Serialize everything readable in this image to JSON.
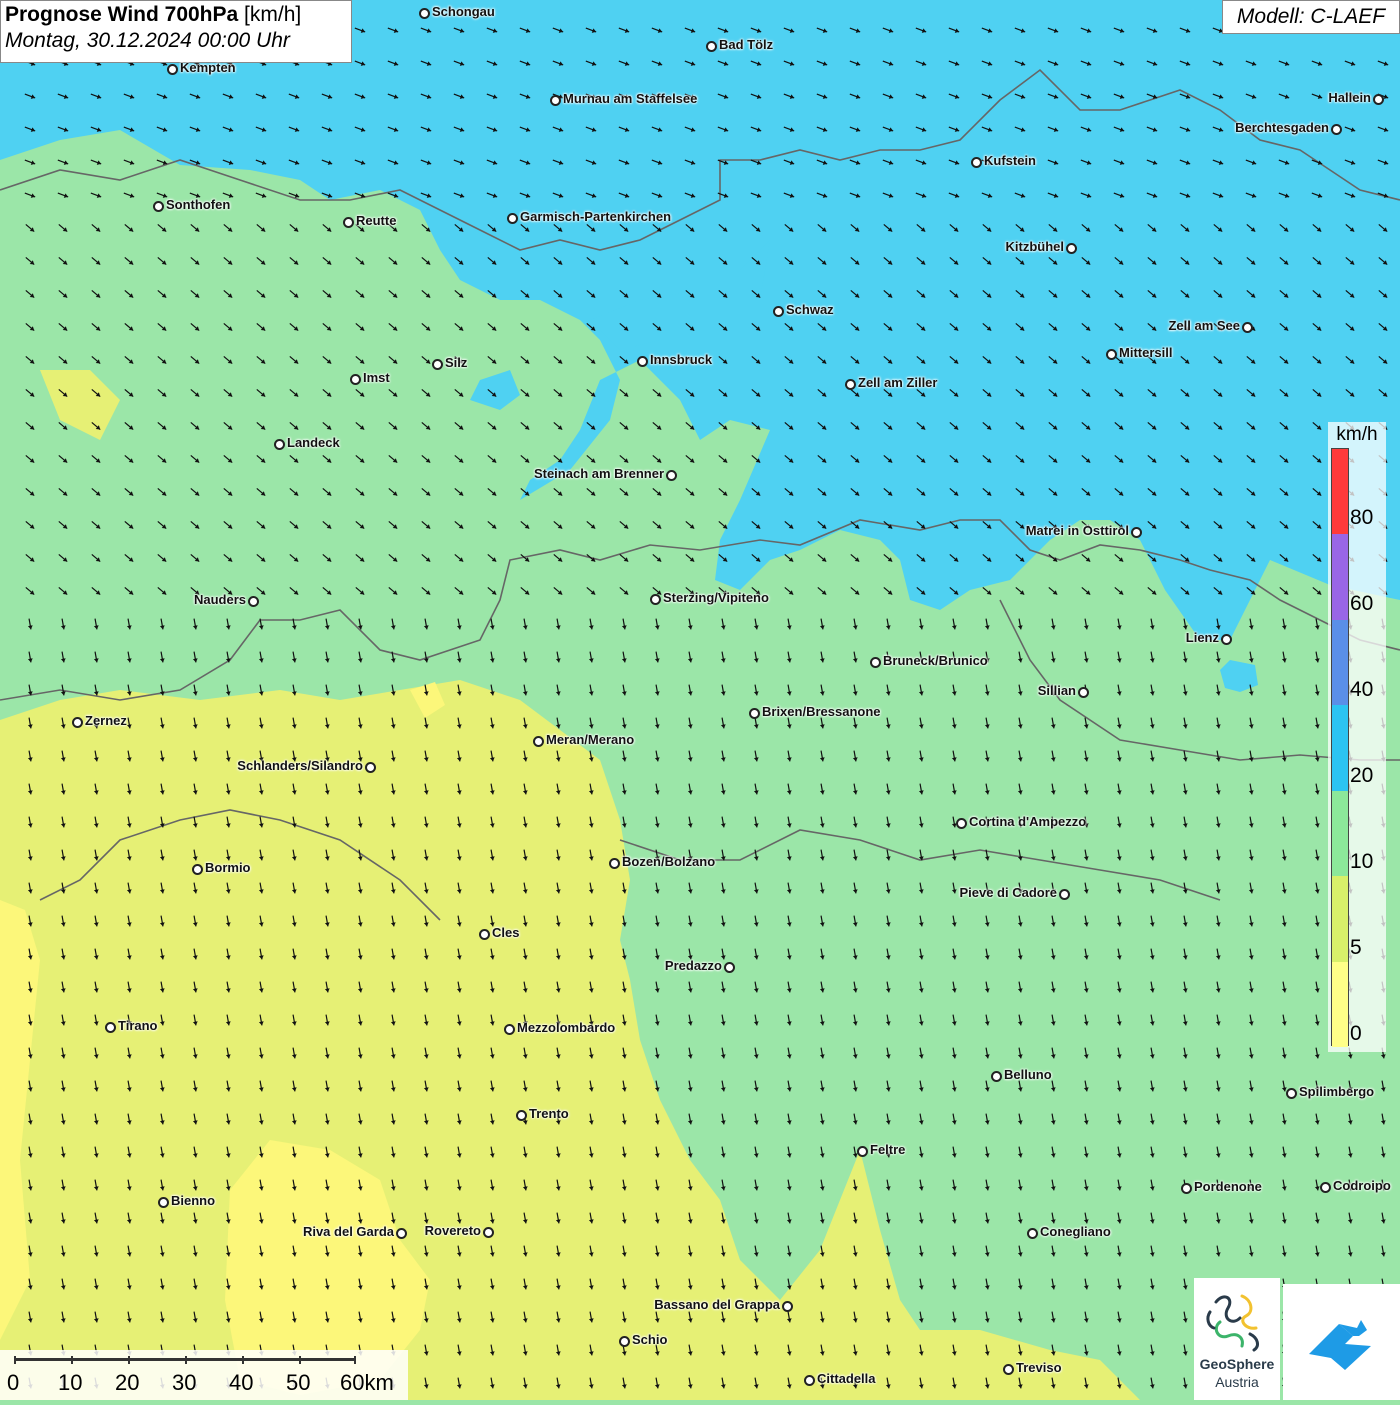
{
  "title": {
    "main": "Prognose Wind 700hPa",
    "unit": "[km/h]",
    "date": "Montag, 30.12.2024 00:00 Uhr"
  },
  "model": "Modell: C-LAEF",
  "legend": {
    "unit": "km/h",
    "labels": [
      "80",
      "60",
      "40",
      "20",
      "10",
      "5",
      "0"
    ],
    "colors": [
      "#ff3a3a",
      "#9966e6",
      "#5a8fe8",
      "#2cc4f2",
      "#8ce89a",
      "#d8f06a",
      "#ffff88"
    ]
  },
  "scale": {
    "labels": [
      "0",
      "10",
      "20",
      "30",
      "40",
      "50",
      "60km"
    ]
  },
  "logos": {
    "geosphere_name": "GeoSphere",
    "geosphere_sub": "Austria"
  },
  "colors": {
    "strong": "#4fd1f2",
    "medium": "#9be6a8",
    "weak": "#e6f075",
    "calm": "#fcf77a"
  },
  "cities": [
    {
      "name": "Schongau"
    },
    {
      "name": "Bad Tölz"
    },
    {
      "name": "Kempten"
    },
    {
      "name": "Murnau am Staffelsee"
    },
    {
      "name": "Hallein"
    },
    {
      "name": "Berchtesgaden"
    },
    {
      "name": "Kufstein"
    },
    {
      "name": "Sonthofen"
    },
    {
      "name": "Reutte"
    },
    {
      "name": "Garmisch-Partenkirchen"
    },
    {
      "name": "Kitzbühel"
    },
    {
      "name": "Schwaz"
    },
    {
      "name": "Zell am See"
    },
    {
      "name": "Innsbruck"
    },
    {
      "name": "Mittersill"
    },
    {
      "name": "Silz"
    },
    {
      "name": "Imst"
    },
    {
      "name": "Zell am Ziller"
    },
    {
      "name": "Landeck"
    },
    {
      "name": "Steinach am Brenner"
    },
    {
      "name": "Matrei in Osttirol"
    },
    {
      "name": "Nauders"
    },
    {
      "name": "Sterzing/Vipiteno"
    },
    {
      "name": "Lienz"
    },
    {
      "name": "Bruneck/Brunico"
    },
    {
      "name": "Sillian"
    },
    {
      "name": "Zernez"
    },
    {
      "name": "Brixen/Bressanone"
    },
    {
      "name": "Meran/Merano"
    },
    {
      "name": "Schlanders/Silandro"
    },
    {
      "name": "Cortina d'Ampezzo"
    },
    {
      "name": "Bozen/Bolzano"
    },
    {
      "name": "Bormio"
    },
    {
      "name": "Pieve di Cadore"
    },
    {
      "name": "Cles"
    },
    {
      "name": "Predazzo"
    },
    {
      "name": "Tirano"
    },
    {
      "name": "Mezzolombardo"
    },
    {
      "name": "Belluno"
    },
    {
      "name": "Spilimbergo"
    },
    {
      "name": "Trento"
    },
    {
      "name": "Feltre"
    },
    {
      "name": "Pordenone"
    },
    {
      "name": "Codroipo"
    },
    {
      "name": "Bienno"
    },
    {
      "name": "Riva del Garda"
    },
    {
      "name": "Rovereto"
    },
    {
      "name": "Conegliano"
    },
    {
      "name": "Bassano del Grappa"
    },
    {
      "name": "Schio"
    },
    {
      "name": "Treviso"
    },
    {
      "name": "Cittadella"
    }
  ]
}
